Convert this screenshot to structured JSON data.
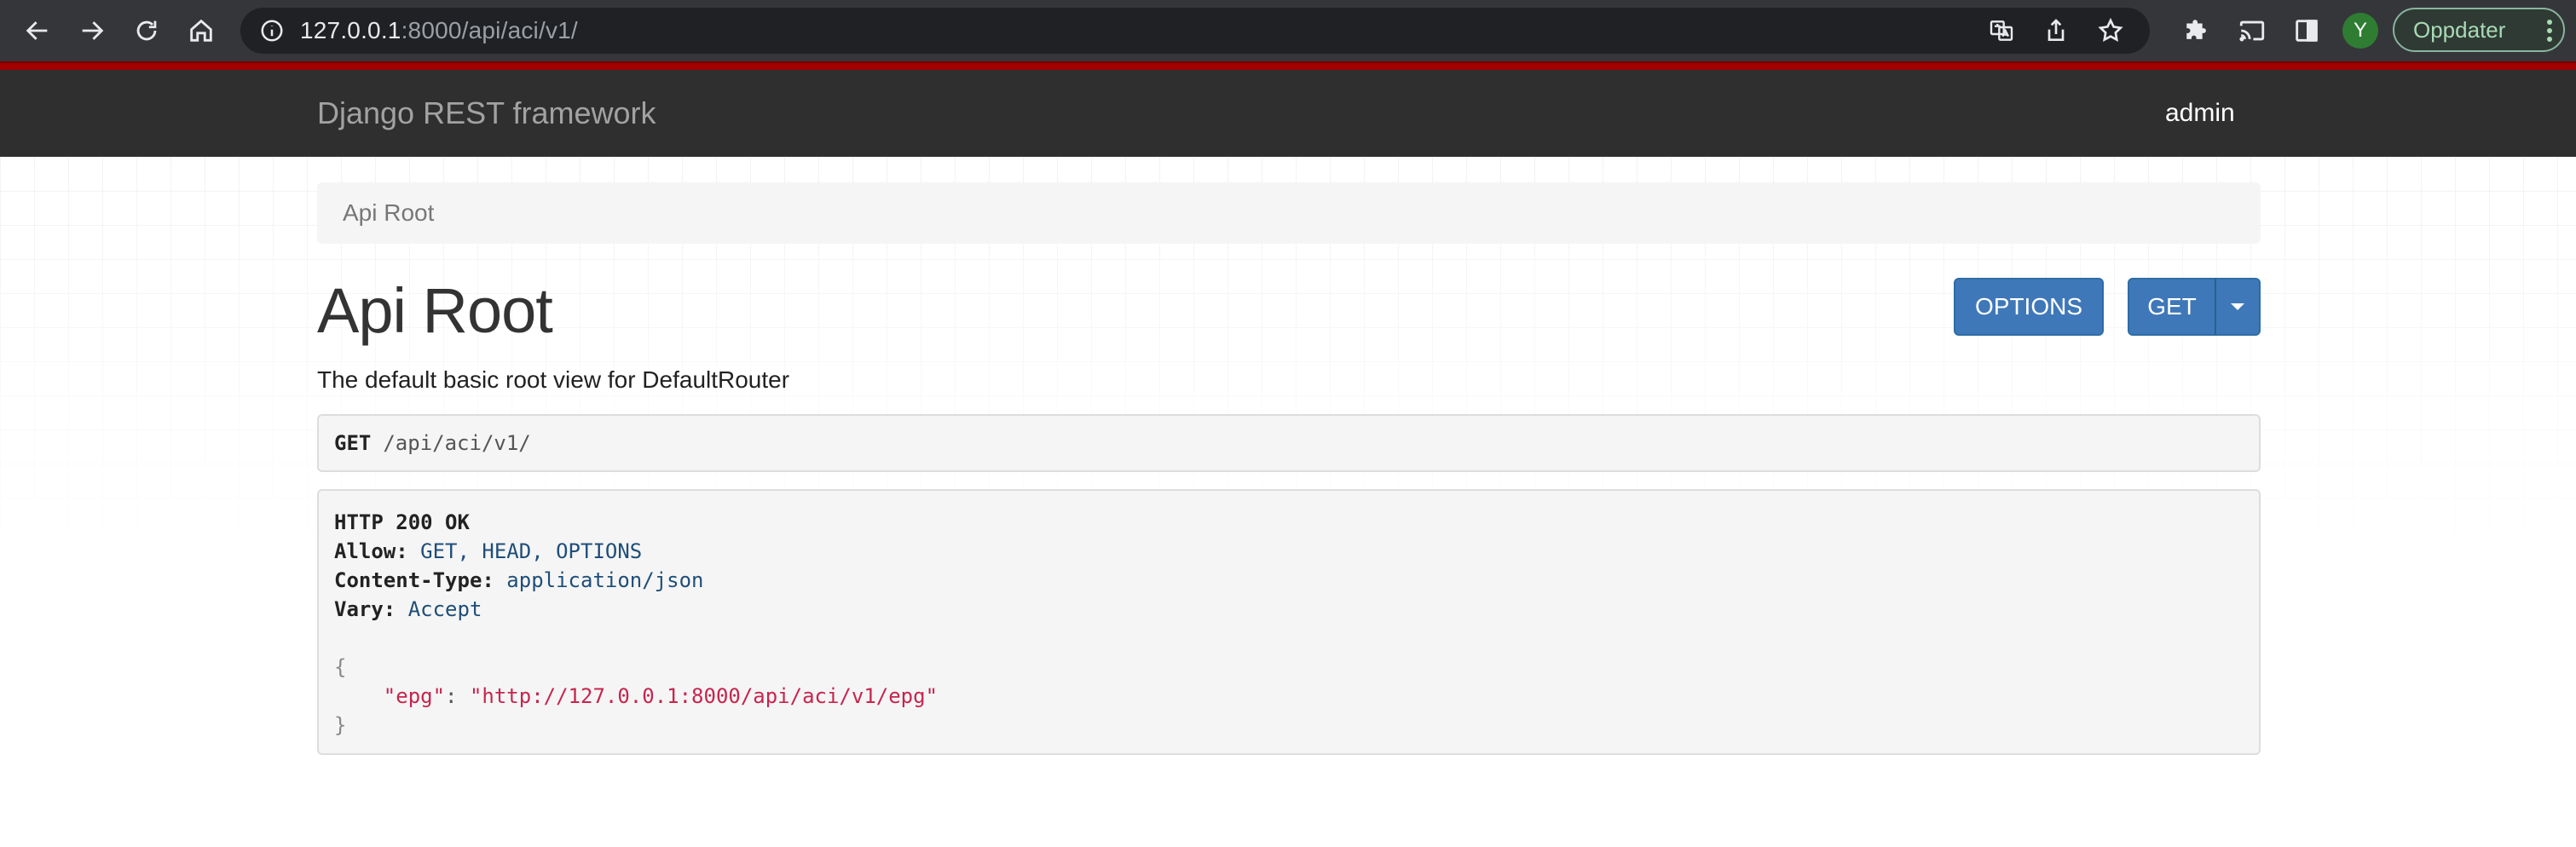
{
  "browser": {
    "url_host": "127.0.0.1",
    "url_rest": ":8000/api/aci/v1/",
    "avatar_letter": "Y",
    "update_label": "Oppdater"
  },
  "navbar": {
    "brand": "Django REST framework",
    "user": "admin"
  },
  "breadcrumb": {
    "items": [
      "Api Root"
    ]
  },
  "page": {
    "title": "Api Root",
    "description": "The default basic root view for DefaultRouter",
    "options_label": "OPTIONS",
    "get_label": "GET"
  },
  "request": {
    "method": "GET",
    "path": "/api/aci/v1/"
  },
  "response": {
    "status": "HTTP 200 OK",
    "headers": [
      {
        "name": "Allow:",
        "value": "GET, HEAD, OPTIONS"
      },
      {
        "name": "Content-Type:",
        "value": "application/json"
      },
      {
        "name": "Vary:",
        "value": "Accept"
      }
    ],
    "body": {
      "open": "{",
      "key": "\"epg\"",
      "sep": ": ",
      "value": "\"http://127.0.0.1:8000/api/aci/v1/epg\"",
      "close": "}"
    }
  },
  "colors": {
    "navbar_bg": "#2f2f2f",
    "accent_red": "#a30000",
    "button_blue": "#3f78b8",
    "json_string": "#c7254e"
  }
}
